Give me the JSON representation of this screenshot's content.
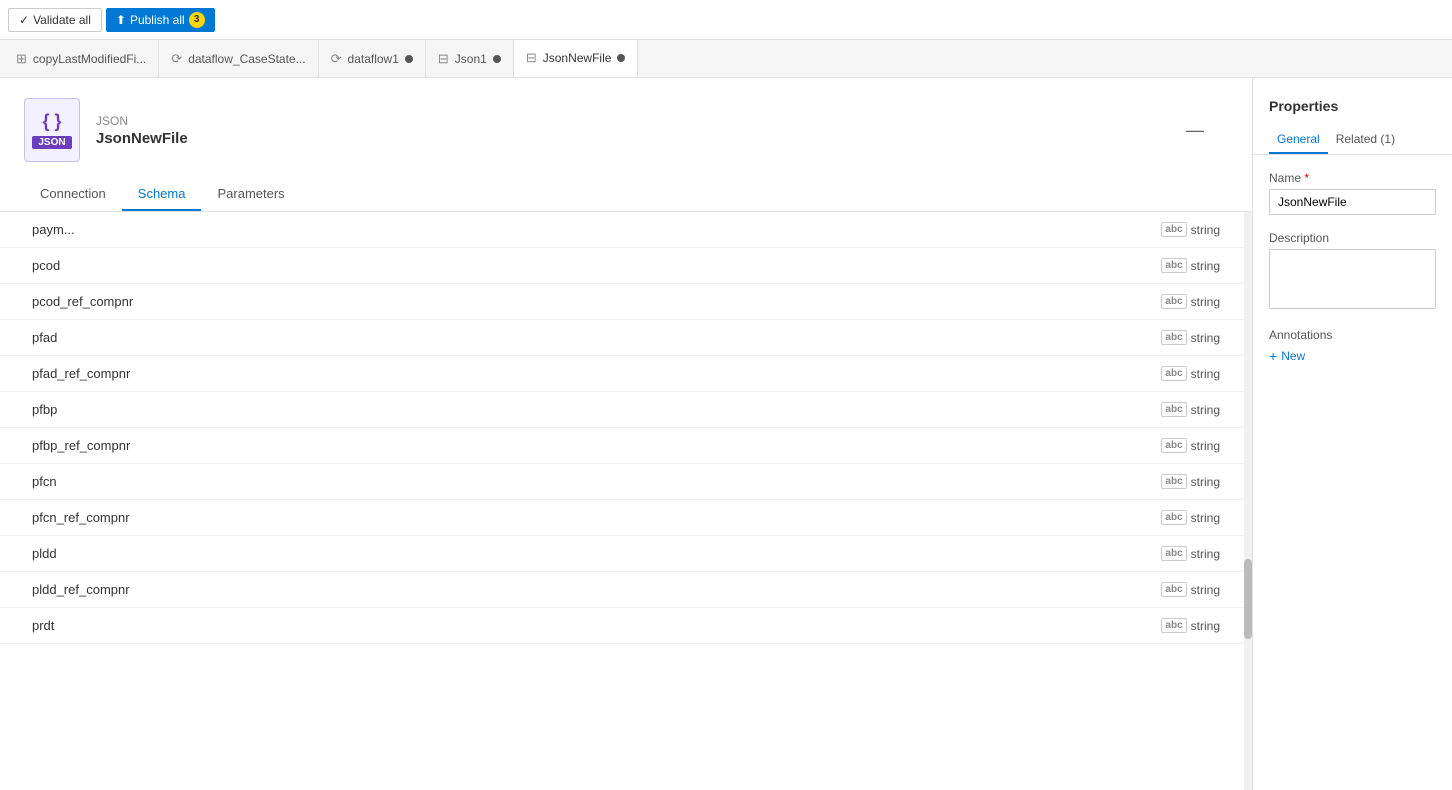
{
  "topbar": {
    "validate_label": "Validate all",
    "publish_label": "Publish all",
    "publish_count": "3"
  },
  "tabs": [
    {
      "id": "copyLastModifiedFi",
      "label": "copyLastModifiedFi...",
      "icon": "grid",
      "active": false,
      "dot": false
    },
    {
      "id": "dataflow_CaseState",
      "label": "dataflow_CaseState...",
      "icon": "dataflow",
      "active": false,
      "dot": false
    },
    {
      "id": "dataflow1",
      "label": "dataflow1",
      "icon": "dataflow",
      "active": false,
      "dot": true
    },
    {
      "id": "Json1",
      "label": "Json1",
      "icon": "table",
      "active": false,
      "dot": true
    },
    {
      "id": "JsonNewFile",
      "label": "JsonNewFile",
      "icon": "table",
      "active": true,
      "dot": true
    }
  ],
  "file_header": {
    "type_label": "JSON",
    "file_name": "JsonNewFile",
    "icon_braces": "{ }",
    "icon_label": "JSON"
  },
  "sub_tabs": [
    {
      "id": "connection",
      "label": "Connection",
      "active": false
    },
    {
      "id": "schema",
      "label": "Schema",
      "active": true
    },
    {
      "id": "parameters",
      "label": "Parameters",
      "active": false
    }
  ],
  "schema_rows": [
    {
      "name": "paym...",
      "type": "string"
    },
    {
      "name": "pcod",
      "type": "string"
    },
    {
      "name": "pcod_ref_compnr",
      "type": "string"
    },
    {
      "name": "pfad",
      "type": "string"
    },
    {
      "name": "pfad_ref_compnr",
      "type": "string"
    },
    {
      "name": "pfbp",
      "type": "string"
    },
    {
      "name": "pfbp_ref_compnr",
      "type": "string"
    },
    {
      "name": "pfcn",
      "type": "string"
    },
    {
      "name": "pfcn_ref_compnr",
      "type": "string"
    },
    {
      "name": "pldd",
      "type": "string"
    },
    {
      "name": "pldd_ref_compnr",
      "type": "string"
    },
    {
      "name": "prdt",
      "type": "string"
    }
  ],
  "properties": {
    "title": "Properties",
    "tabs": [
      {
        "id": "general",
        "label": "General",
        "active": true
      },
      {
        "id": "related",
        "label": "Related (1)",
        "active": false
      }
    ],
    "name_label": "Name",
    "name_required": true,
    "name_value": "JsonNewFile",
    "description_label": "Description",
    "description_value": "",
    "annotations_label": "Annotations",
    "new_label": "New"
  }
}
